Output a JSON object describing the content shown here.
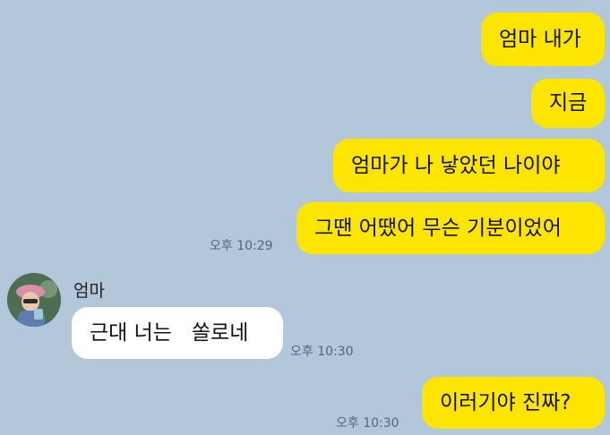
{
  "chat": {
    "messages_out": [
      {
        "text": "엄마 내가"
      },
      {
        "text": "지금"
      },
      {
        "text": "엄마가 나 낳았던 나이야"
      },
      {
        "text": "그땐 어땠어 무슨 기분이었어"
      }
    ],
    "time_out_1": "오후 10:29",
    "sender_name": "엄마",
    "message_in": "근대 너는   쏠로네",
    "time_in": "오후 10:30",
    "message_out_last": "이러기야 진짜?",
    "time_out_2": "오후 10:30"
  },
  "colors": {
    "background": "#b2c7da",
    "my_bubble": "#fee500",
    "their_bubble": "#ffffff"
  }
}
